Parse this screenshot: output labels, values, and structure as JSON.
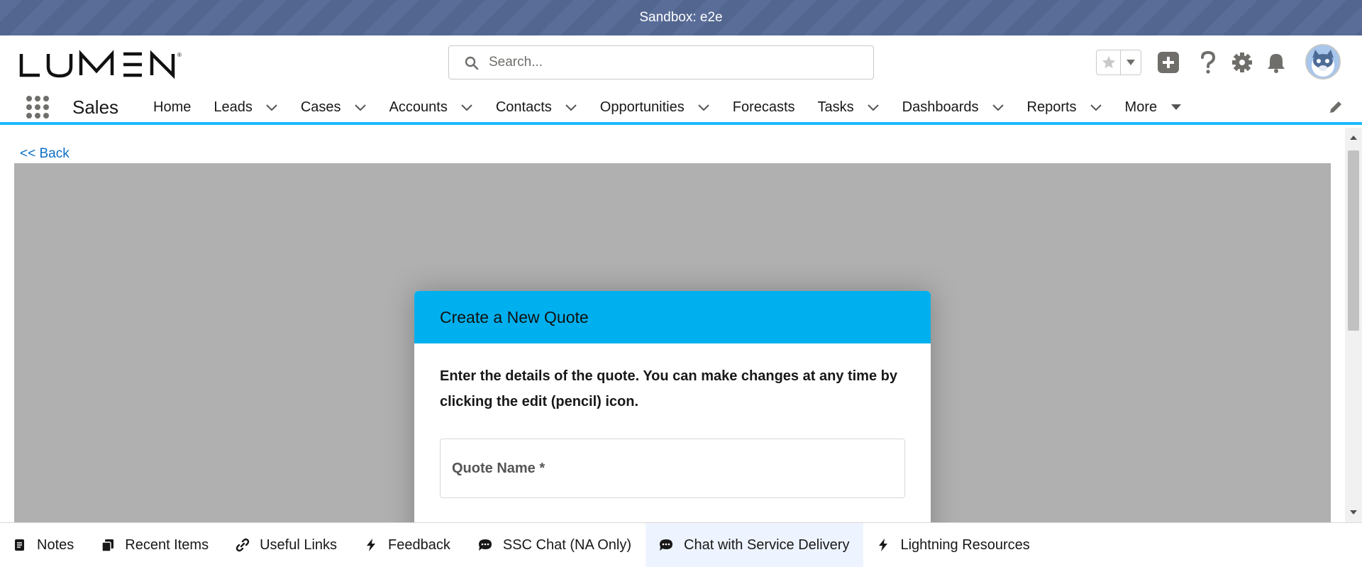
{
  "sandbox": {
    "label": "Sandbox: e2e"
  },
  "header": {
    "logo_text": "LUMEN",
    "search": {
      "placeholder": "Search..."
    },
    "icons": [
      "favorites-star-icon",
      "favorites-dropdown-icon",
      "global-actions-plus-icon",
      "help-icon",
      "setup-gear-icon",
      "notifications-bell-icon",
      "user-avatar"
    ]
  },
  "nav": {
    "app_name": "Sales",
    "items": [
      {
        "label": "Home",
        "dropdown": false
      },
      {
        "label": "Leads",
        "dropdown": true
      },
      {
        "label": "Cases",
        "dropdown": true
      },
      {
        "label": "Accounts",
        "dropdown": true
      },
      {
        "label": "Contacts",
        "dropdown": true
      },
      {
        "label": "Opportunities",
        "dropdown": true
      },
      {
        "label": "Forecasts",
        "dropdown": false
      },
      {
        "label": "Tasks",
        "dropdown": true
      },
      {
        "label": "Dashboards",
        "dropdown": true
      },
      {
        "label": "Reports",
        "dropdown": true
      },
      {
        "label": "More",
        "dropdown": true
      }
    ]
  },
  "content": {
    "back_label": "<< Back"
  },
  "modal": {
    "title": "Create a New Quote",
    "description": "Enter the details of the quote. You can make changes at any time by clicking the edit (pencil) icon.",
    "quote_name_label": "Quote Name *"
  },
  "utility_bar": {
    "items": [
      {
        "label": "Notes",
        "icon": "notes-icon"
      },
      {
        "label": "Recent Items",
        "icon": "recent-items-icon"
      },
      {
        "label": "Useful Links",
        "icon": "link-icon"
      },
      {
        "label": "Feedback",
        "icon": "lightning-icon"
      },
      {
        "label": "SSC Chat (NA Only)",
        "icon": "chat-icon"
      },
      {
        "label": "Chat with Service Delivery",
        "icon": "chat-icon",
        "active": true
      },
      {
        "label": "Lightning Resources",
        "icon": "lightning-icon"
      }
    ]
  },
  "colors": {
    "accent": "#1ab9ff",
    "modal_header": "#00b0ee",
    "link": "#0b6fc5"
  }
}
